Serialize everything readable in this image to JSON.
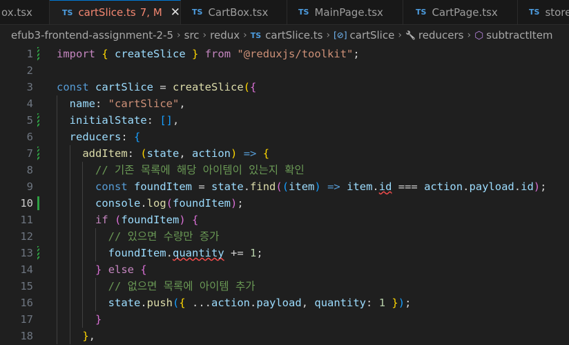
{
  "tabs": [
    {
      "label": "ox.tsx",
      "ts": "",
      "status": ""
    },
    {
      "label": "cartSlice.ts",
      "ts": "TS",
      "status": "7, M",
      "close": "✕"
    },
    {
      "label": "CartBox.tsx",
      "ts": "TS",
      "status": ""
    },
    {
      "label": "MainPage.tsx",
      "ts": "TS",
      "status": ""
    },
    {
      "label": "CartPage.tsx",
      "ts": "TS",
      "status": ""
    },
    {
      "label": "store",
      "ts": "TS",
      "status": ""
    }
  ],
  "breadcrumb": {
    "root": "efub3-frontend-assignment-2-5",
    "src": "src",
    "redux": "redux",
    "file_badge": "TS",
    "file": "cartSlice.ts",
    "var_icon": "[⊘]",
    "var": "cartSlice",
    "wrench_icon": "🔧",
    "reducers": "reducers",
    "cube_icon": "⬡",
    "subtract": "subtractItem",
    "sep": "›"
  },
  "current_line": 10,
  "lines": [
    {
      "n": "1",
      "tokens": [
        [
          "kw2",
          "import"
        ],
        [
          "pl",
          " "
        ],
        [
          "b1",
          "{"
        ],
        [
          "pl",
          " "
        ],
        [
          "var",
          "createSlice"
        ],
        [
          "pl",
          " "
        ],
        [
          "b1",
          "}"
        ],
        [
          "pl",
          " "
        ],
        [
          "kw2",
          "from"
        ],
        [
          "pl",
          " "
        ],
        [
          "str",
          "\"@reduxjs/toolkit\""
        ],
        [
          "pl",
          ";"
        ]
      ]
    },
    {
      "n": "2",
      "tokens": []
    },
    {
      "n": "3",
      "tokens": [
        [
          "kw",
          "const"
        ],
        [
          "pl",
          " "
        ],
        [
          "var",
          "cartSlice"
        ],
        [
          "pl",
          " = "
        ],
        [
          "fn",
          "createSlice"
        ],
        [
          "b1",
          "("
        ],
        [
          "b2",
          "{"
        ]
      ]
    },
    {
      "n": "4",
      "tokens": [
        [
          "pl",
          "  "
        ],
        [
          "var",
          "name"
        ],
        [
          "pl",
          ": "
        ],
        [
          "str",
          "\"cartSlice\""
        ],
        [
          "pl",
          ","
        ]
      ]
    },
    {
      "n": "5",
      "tokens": [
        [
          "pl",
          "  "
        ],
        [
          "var",
          "initialState"
        ],
        [
          "pl",
          ": "
        ],
        [
          "b3",
          "[]"
        ],
        [
          "pl",
          ","
        ]
      ]
    },
    {
      "n": "6",
      "tokens": [
        [
          "pl",
          "  "
        ],
        [
          "var",
          "reducers"
        ],
        [
          "pl",
          ": "
        ],
        [
          "b3",
          "{"
        ]
      ]
    },
    {
      "n": "7",
      "tokens": [
        [
          "pl",
          "    "
        ],
        [
          "fn",
          "addItem"
        ],
        [
          "pl",
          ": "
        ],
        [
          "b1",
          "("
        ],
        [
          "var",
          "state"
        ],
        [
          "pl",
          ", "
        ],
        [
          "var",
          "action"
        ],
        [
          "b1",
          ")"
        ],
        [
          "pl",
          " "
        ],
        [
          "kw",
          "=>"
        ],
        [
          "pl",
          " "
        ],
        [
          "b1",
          "{"
        ]
      ]
    },
    {
      "n": "8",
      "tokens": [
        [
          "pl",
          "      "
        ],
        [
          "cmt",
          "// 기존 목록에 해당 아이템이 있는지 확인"
        ]
      ]
    },
    {
      "n": "9",
      "tokens": [
        [
          "pl",
          "      "
        ],
        [
          "kw",
          "const"
        ],
        [
          "pl",
          " "
        ],
        [
          "var",
          "foundItem"
        ],
        [
          "pl",
          " = "
        ],
        [
          "var",
          "state"
        ],
        [
          "pl",
          "."
        ],
        [
          "fn",
          "find"
        ],
        [
          "b2",
          "("
        ],
        [
          "b3",
          "("
        ],
        [
          "var",
          "item"
        ],
        [
          "b3",
          ")"
        ],
        [
          "pl",
          " "
        ],
        [
          "kw",
          "=>"
        ],
        [
          "pl",
          " "
        ],
        [
          "var",
          "item"
        ],
        [
          "pl",
          "."
        ],
        [
          "var sq",
          "id"
        ],
        [
          "pl",
          " === "
        ],
        [
          "var",
          "action"
        ],
        [
          "pl",
          "."
        ],
        [
          "var",
          "payload"
        ],
        [
          "pl",
          "."
        ],
        [
          "var",
          "id"
        ],
        [
          "b2",
          ")"
        ],
        [
          "pl",
          ";"
        ]
      ]
    },
    {
      "n": "10",
      "tokens": [
        [
          "pl",
          "      "
        ],
        [
          "var",
          "console"
        ],
        [
          "pl",
          "."
        ],
        [
          "fn",
          "log"
        ],
        [
          "b2",
          "("
        ],
        [
          "var",
          "foundItem"
        ],
        [
          "b2",
          ")"
        ],
        [
          "pl",
          ";"
        ]
      ]
    },
    {
      "n": "11",
      "tokens": [
        [
          "pl",
          "      "
        ],
        [
          "kw2",
          "if"
        ],
        [
          "pl",
          " "
        ],
        [
          "b2",
          "("
        ],
        [
          "var",
          "foundItem"
        ],
        [
          "b2",
          ")"
        ],
        [
          "pl",
          " "
        ],
        [
          "b2",
          "{"
        ]
      ]
    },
    {
      "n": "12",
      "tokens": [
        [
          "pl",
          "        "
        ],
        [
          "cmt",
          "// 있으면 수량만 증가"
        ]
      ]
    },
    {
      "n": "13",
      "tokens": [
        [
          "pl",
          "        "
        ],
        [
          "var",
          "foundItem"
        ],
        [
          "pl",
          "."
        ],
        [
          "var sq",
          "quantity"
        ],
        [
          "pl",
          " += "
        ],
        [
          "num",
          "1"
        ],
        [
          "pl",
          ";"
        ]
      ]
    },
    {
      "n": "14",
      "tokens": [
        [
          "pl",
          "      "
        ],
        [
          "b2",
          "}"
        ],
        [
          "pl",
          " "
        ],
        [
          "kw2",
          "else"
        ],
        [
          "pl",
          " "
        ],
        [
          "b2",
          "{"
        ]
      ]
    },
    {
      "n": "15",
      "tokens": [
        [
          "pl",
          "        "
        ],
        [
          "cmt",
          "// 없으면 목록에 아이템 추가"
        ]
      ]
    },
    {
      "n": "16",
      "tokens": [
        [
          "pl",
          "        "
        ],
        [
          "var",
          "state"
        ],
        [
          "pl",
          "."
        ],
        [
          "fn",
          "push"
        ],
        [
          "b3",
          "("
        ],
        [
          "b1",
          "{"
        ],
        [
          "pl",
          " ..."
        ],
        [
          "var",
          "action"
        ],
        [
          "pl",
          "."
        ],
        [
          "var",
          "payload"
        ],
        [
          "pl",
          ", "
        ],
        [
          "var",
          "quantity"
        ],
        [
          "pl",
          ": "
        ],
        [
          "num",
          "1"
        ],
        [
          "pl",
          " "
        ],
        [
          "b1",
          "}"
        ],
        [
          "b3",
          ")"
        ],
        [
          "pl",
          ";"
        ]
      ]
    },
    {
      "n": "17",
      "tokens": [
        [
          "pl",
          "      "
        ],
        [
          "b2",
          "}"
        ]
      ]
    },
    {
      "n": "18",
      "tokens": [
        [
          "pl",
          "    "
        ],
        [
          "b1",
          "}"
        ],
        [
          "pl",
          ","
        ]
      ]
    }
  ],
  "gutter_marks": {
    "1": "hatch",
    "5": "hatch",
    "7": "hatch",
    "10": "solid",
    "13": "hatch"
  }
}
